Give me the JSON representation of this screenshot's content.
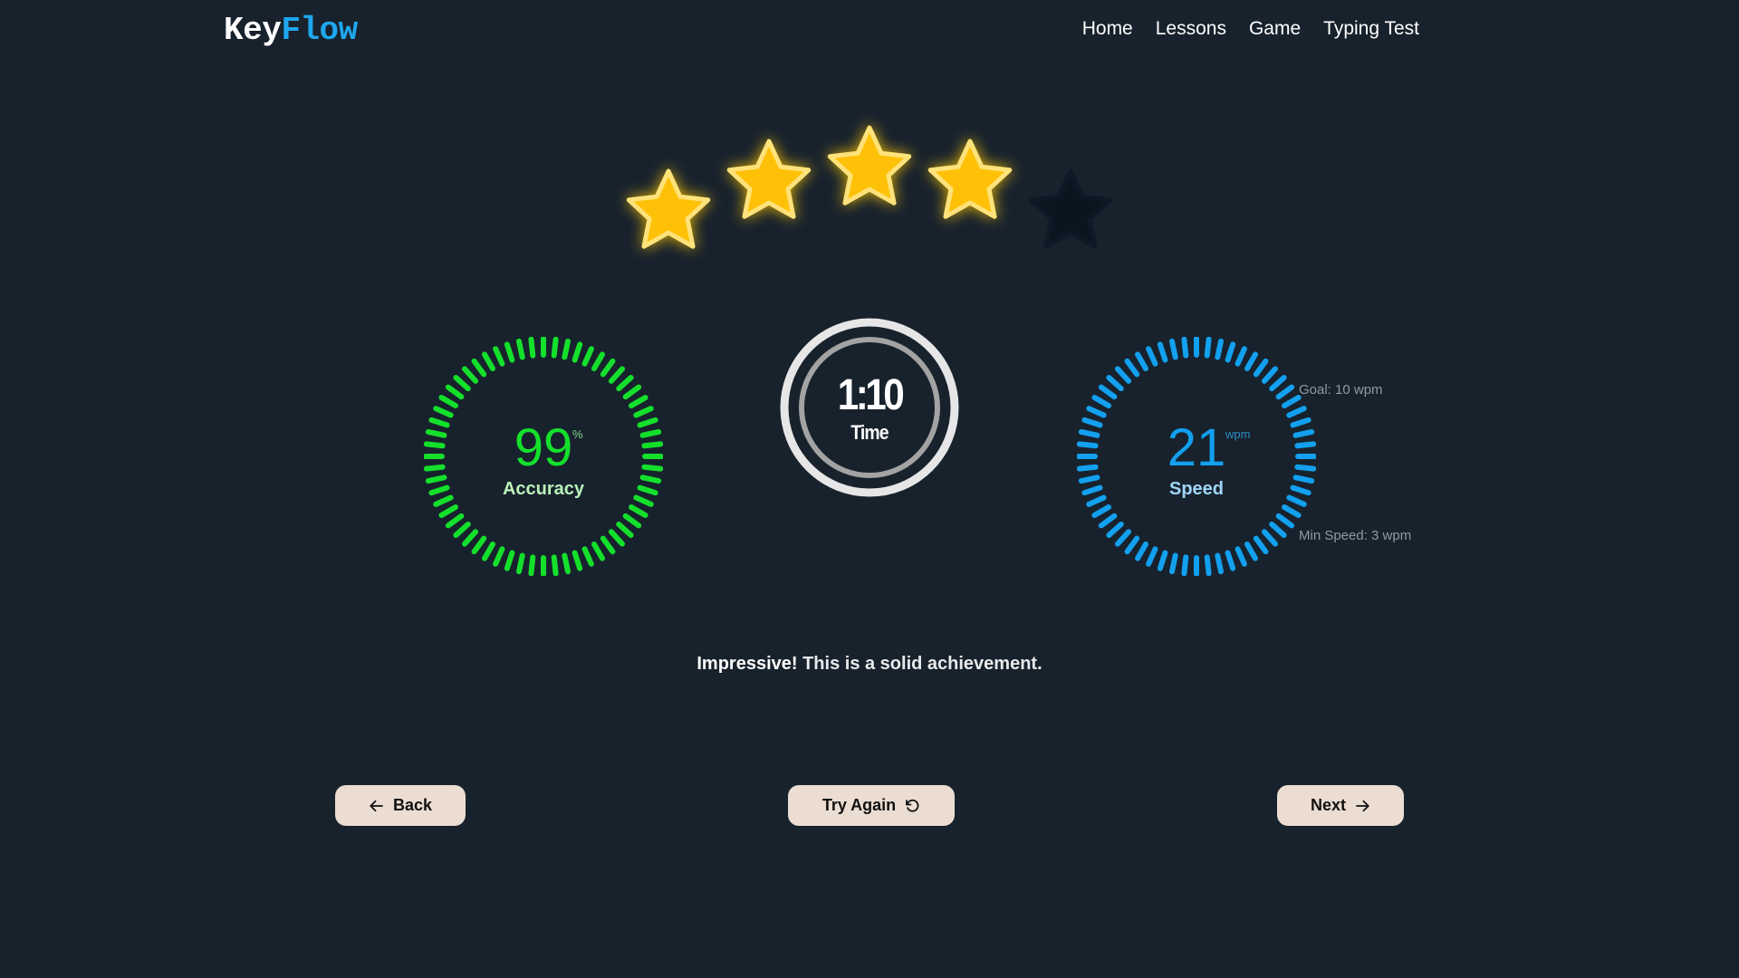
{
  "header": {
    "logo": {
      "part1": "Key",
      "part2": "Flow"
    },
    "nav": [
      "Home",
      "Lessons",
      "Game",
      "Typing Test"
    ]
  },
  "rating": {
    "stars_earned": 4,
    "stars_total": 5,
    "colors": {
      "on": "#ffc107",
      "off": "#0b1520"
    }
  },
  "accuracy": {
    "value": "99",
    "unit": "%",
    "label": "Accuracy",
    "fill_fraction": 1.0,
    "color": "#14e02c",
    "label_color": "#b9f2b9"
  },
  "time": {
    "value": "1:10",
    "label": "Time"
  },
  "speed": {
    "value": "21",
    "unit": "wpm",
    "label": "Speed",
    "goal_note": "Goal: 10 wpm",
    "min_note": "Min Speed: 3 wpm",
    "fill_fraction": 1.0,
    "color": "#12a0ef",
    "label_color": "#9fd6f8"
  },
  "message": {
    "strong": "Impressive!",
    "rest": " This is a solid achievement."
  },
  "buttons": {
    "back": {
      "label": "Back",
      "icon": "arrow-left-icon"
    },
    "try_again": {
      "label": "Try Again",
      "icon": "rotate-ccw-icon"
    },
    "next": {
      "label": "Next",
      "icon": "arrow-right-icon"
    }
  },
  "colors": {
    "background": "#18222d",
    "brand": "#1ea7ee",
    "button_bg": "#ecddd2"
  }
}
